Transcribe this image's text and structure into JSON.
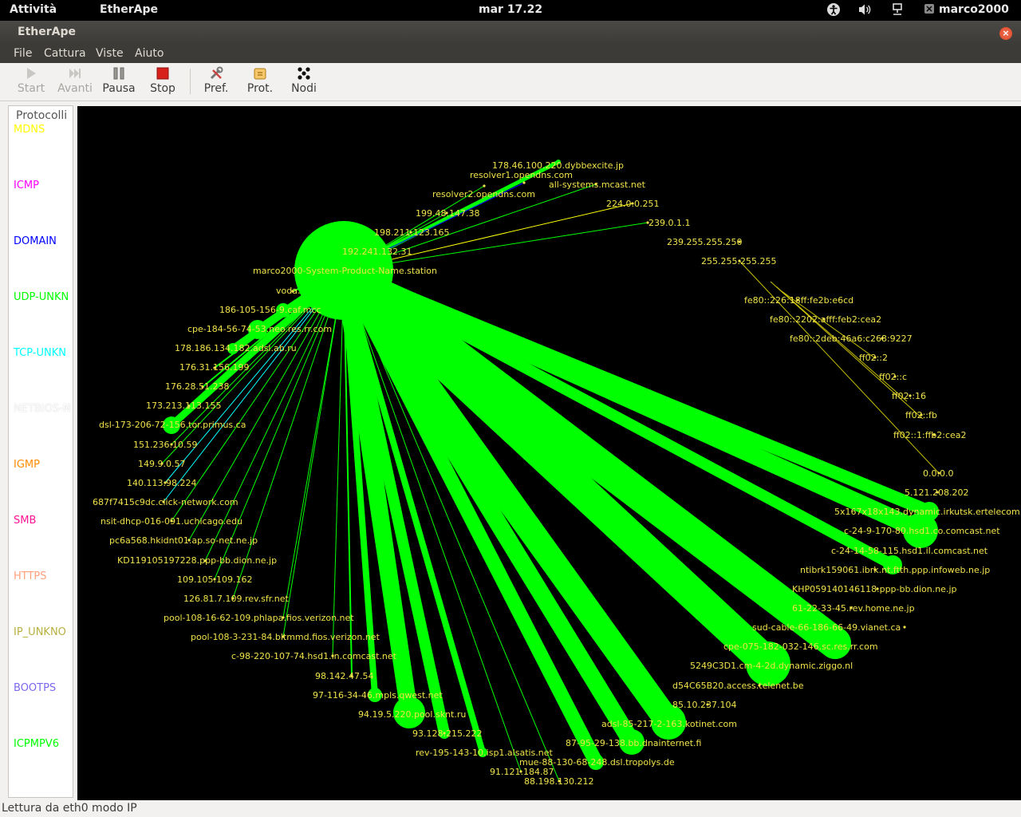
{
  "topbar": {
    "activities": "Attività",
    "app_name": "EtherApe",
    "clock": "mar 17.22",
    "user": "marco2000"
  },
  "window": {
    "title": "EtherApe"
  },
  "menu": {
    "items": [
      "File",
      "Cattura",
      "Viste",
      "Aiuto"
    ]
  },
  "toolbar": {
    "buttons": [
      {
        "label": "Start",
        "enabled": false,
        "icon": "play-icon"
      },
      {
        "label": "Avanti",
        "enabled": false,
        "icon": "step-forward-icon"
      },
      {
        "label": "Pausa",
        "enabled": true,
        "icon": "pause-icon"
      },
      {
        "label": "Stop",
        "enabled": true,
        "icon": "stop-icon"
      },
      {
        "label": "Pref.",
        "enabled": true,
        "icon": "preferences-icon"
      },
      {
        "label": "Prot.",
        "enabled": true,
        "icon": "protocols-icon"
      },
      {
        "label": "Nodi",
        "enabled": true,
        "icon": "nodes-icon"
      }
    ]
  },
  "legend": {
    "header": "Protocolli",
    "protocols": [
      {
        "name": "MDNS",
        "color": "#ffff00"
      },
      {
        "name": "ICMP",
        "color": "#ff00ff"
      },
      {
        "name": "DOMAIN",
        "color": "#0000ff"
      },
      {
        "name": "UDP-UNKN",
        "color": "#00ff00"
      },
      {
        "name": "TCP-UNKN",
        "color": "#00ffff"
      },
      {
        "name": "NETBIOS-N",
        "color": "#ffffff"
      },
      {
        "name": "IGMP",
        "color": "#ff8c00"
      },
      {
        "name": "SMB",
        "color": "#ff1493"
      },
      {
        "name": "HTTPS",
        "color": "#ffa07a"
      },
      {
        "name": "IP_UNKNO",
        "color": "#b8b040"
      },
      {
        "name": "BOOTPS",
        "color": "#7b68ee"
      },
      {
        "name": "ICPMPV6",
        "color": "#00ff00"
      }
    ]
  },
  "graph": {
    "center_node": "marco2000-System-Product-Name.station",
    "nodes": [
      {
        "label": "178.46.100.220.dybbexcite.jp"
      },
      {
        "label": "resolver1.opendns.com"
      },
      {
        "label": "all-systems.mcast.net"
      },
      {
        "label": "resolver2.opendns.com"
      },
      {
        "label": "224.0.0.251"
      },
      {
        "label": "199.48.147.38"
      },
      {
        "label": "239.0.1.1"
      },
      {
        "label": "198.211.123.165"
      },
      {
        "label": "239.255.255.250"
      },
      {
        "label": "192.241.132.31"
      },
      {
        "label": "255.255.255.255"
      },
      {
        "label": "voda."
      },
      {
        "label": "fe80::226:18ff:fe2b:e6cd"
      },
      {
        "label": "186-105-156-9.caf.mcc"
      },
      {
        "label": "fe80::2202:afff:feb2:cea2"
      },
      {
        "label": "cpe-184-56-74-53.neo.res.rr.com"
      },
      {
        "label": "fe80::2deb:46a6:c268:9227"
      },
      {
        "label": "178.186.134.182.adsl.ab.ru"
      },
      {
        "label": "ff02::2"
      },
      {
        "label": "176.31.156.199"
      },
      {
        "label": "ff02::c"
      },
      {
        "label": "176.28.51.238"
      },
      {
        "label": "ff02::16"
      },
      {
        "label": "173.213.113.155"
      },
      {
        "label": "ff02::fb"
      },
      {
        "label": "dsl-173-206-72-156.tor.primus.ca"
      },
      {
        "label": "ff02::1:ffb2:cea2"
      },
      {
        "label": "151.236.10.59"
      },
      {
        "label": "149.9.0.57"
      },
      {
        "label": "0.0.0.0"
      },
      {
        "label": "140.113.98.224"
      },
      {
        "label": "5.121.208.202"
      },
      {
        "label": "687f7415c9dc.click-network.com"
      },
      {
        "label": "5x167x18x143.dynamic.irkutsk.ertelecom.ru"
      },
      {
        "label": "nsit-dhcp-016-091.uchicago.edu"
      },
      {
        "label": "c-24-9-170-80.hsd1.co.comcast.net"
      },
      {
        "label": "pc6a568.hkidnt01.ap.so-net.ne.jp"
      },
      {
        "label": "c-24-14-58-115.hsd1.il.comcast.net"
      },
      {
        "label": "KD119105197228.ppp-bb.dion.ne.jp"
      },
      {
        "label": "ntibrk159061.ibrk.nt.ftth.ppp.infoweb.ne.jp"
      },
      {
        "label": "109.105.109.162"
      },
      {
        "label": "KHP059140146118.ppp-bb.dion.ne.jp"
      },
      {
        "label": "126.81.7.109.rev.sfr.net"
      },
      {
        "label": "61-22-33-45.rev.home.ne.jp"
      },
      {
        "label": "pool-108-16-62-109.phlapa.fios.verizon.net"
      },
      {
        "label": "sud-cable-66-186-66-49.vianet.ca"
      },
      {
        "label": "pool-108-3-231-84.bltmmd.fios.verizon.net"
      },
      {
        "label": "cpe-075-182-032-146.sc.res.rr.com"
      },
      {
        "label": "c-98-220-107-74.hsd1.in.comcast.net"
      },
      {
        "label": "5249C3D1.cm-4-2d.dynamic.ziggo.nl"
      },
      {
        "label": "98.142.47.54"
      },
      {
        "label": "d54C65B20.access.telenet.be"
      },
      {
        "label": "97-116-34-46.mpls.qwest.net"
      },
      {
        "label": "85.10.237.104"
      },
      {
        "label": "94.19.5.220.pool.sknt.ru"
      },
      {
        "label": "adsl-85-217-2-163.kotinet.com"
      },
      {
        "label": "93.128.215.222"
      },
      {
        "label": "87-95-29-138.bb.dnainternet.fi"
      },
      {
        "label": "rev-195-143-10.isp1.alsatis.net"
      },
      {
        "label": "mue-88-130-68-248.dsl.tropolys.de"
      },
      {
        "label": "91.121.184.87"
      },
      {
        "label": "88.198.130.212"
      }
    ]
  },
  "status": {
    "text": "Lettura da eth0 modo IP"
  },
  "colors": {
    "node": "#00ff00",
    "label": "#f0e24a",
    "canvas": "#000000"
  }
}
